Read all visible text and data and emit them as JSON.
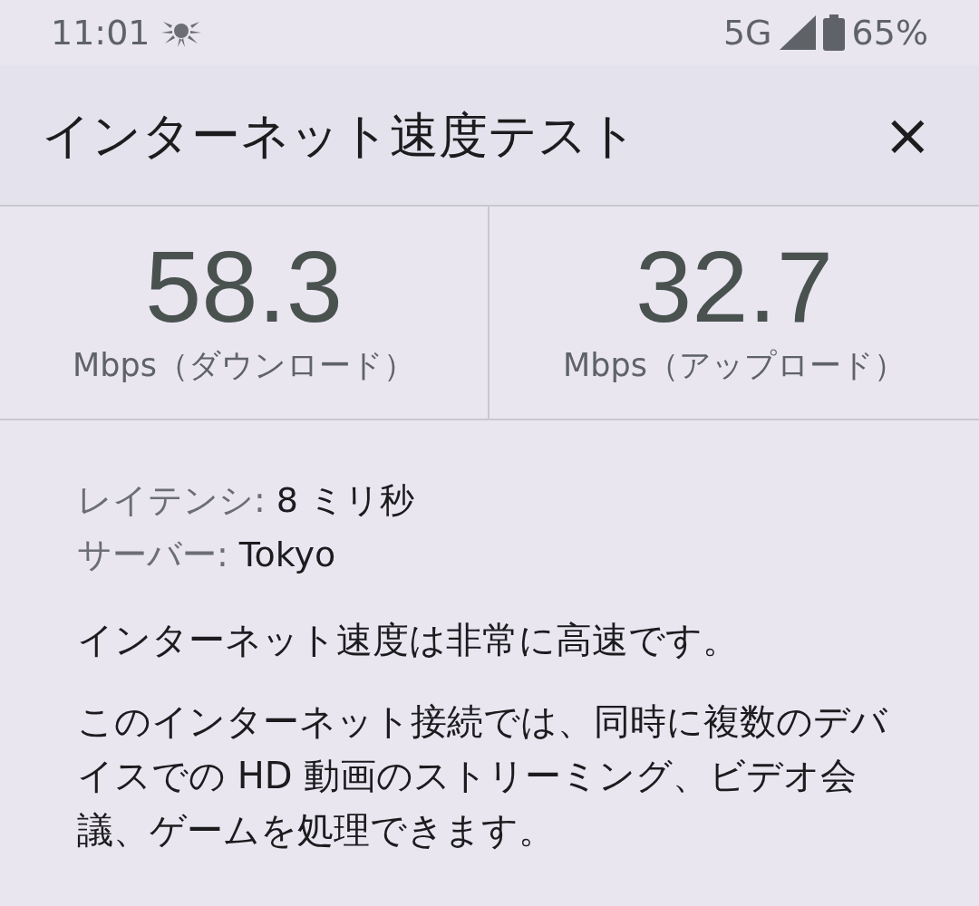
{
  "status_bar": {
    "time": "11:01",
    "network": "5G",
    "battery": "65%"
  },
  "header": {
    "title": "インターネット速度テスト",
    "close": "×"
  },
  "results": [
    {
      "value": "58.3",
      "unit": "Mbps（ダウンロード）"
    },
    {
      "value": "32.7",
      "unit": "Mbps（アップロード）"
    }
  ],
  "details": [
    {
      "label": "レイテンシ:",
      "value": "8 ミリ秒"
    },
    {
      "label": "サーバー:",
      "value": "Tokyo"
    }
  ],
  "summary": "インターネット速度は非常に高速です。",
  "description": "このインターネット接続では、同時に複数のデバイスでの HD 動画のストリーミング、ビデオ会議、ゲームを処理できます。"
}
